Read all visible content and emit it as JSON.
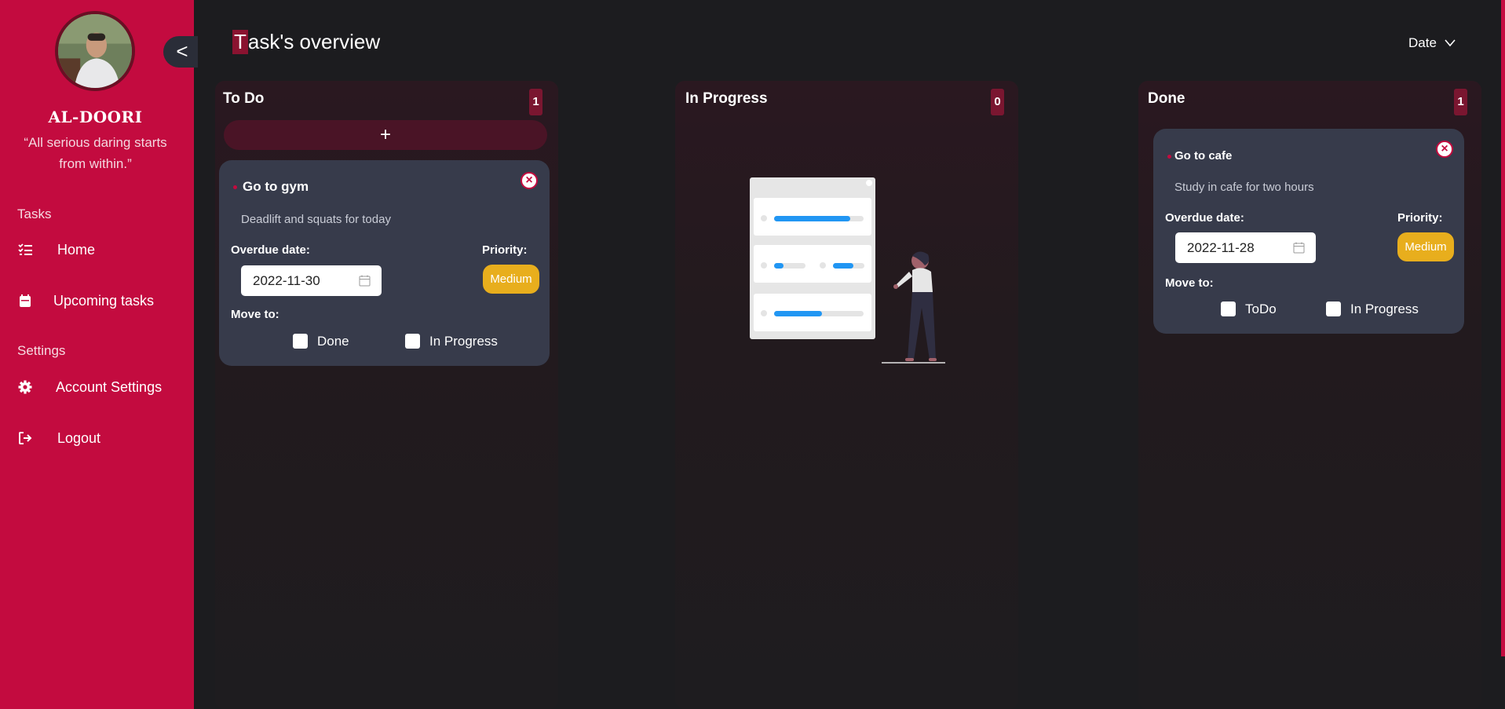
{
  "sidebar": {
    "collapse_label": "<",
    "user_name": "AL-DOORI",
    "quote": "“All serious daring starts from within.”",
    "tasks_section": "Tasks",
    "settings_section": "Settings",
    "items": [
      {
        "label": "Home",
        "icon": "list-check-icon"
      },
      {
        "label": "Upcoming tasks",
        "icon": "calendar-icon"
      },
      {
        "label": "Account Settings",
        "icon": "gear-icon"
      },
      {
        "label": "Logout",
        "icon": "logout-icon"
      }
    ]
  },
  "header": {
    "title_first": "T",
    "title_rest": "ask's overview",
    "sort_label": "Date"
  },
  "columns": [
    {
      "title": "To Do",
      "count": "1",
      "add_label": "+"
    },
    {
      "title": "In Progress",
      "count": "0"
    },
    {
      "title": "Done",
      "count": "1"
    }
  ],
  "cards": {
    "gym": {
      "title": "Go to gym",
      "description": "Deadlift and squats for today",
      "overdue_label": "Overdue date:",
      "date": "2022-11-30",
      "priority_label": "Priority:",
      "priority": "Medium",
      "move_label": "Move to:",
      "options": [
        "Done",
        "In Progress"
      ],
      "close": "×"
    },
    "cafe": {
      "title": "Go to cafe",
      "description": "Study in cafe for two hours",
      "overdue_label": "Overdue date:",
      "date": "2022-11-28",
      "priority_label": "Priority:",
      "priority": "Medium",
      "move_label": "Move to:",
      "options": [
        "ToDo",
        "In Progress"
      ],
      "close": "×"
    }
  },
  "colors": {
    "accent": "#c30b3f",
    "background": "#1c1c1f",
    "card": "#373b4b",
    "priority_medium": "#e8ae1d"
  }
}
